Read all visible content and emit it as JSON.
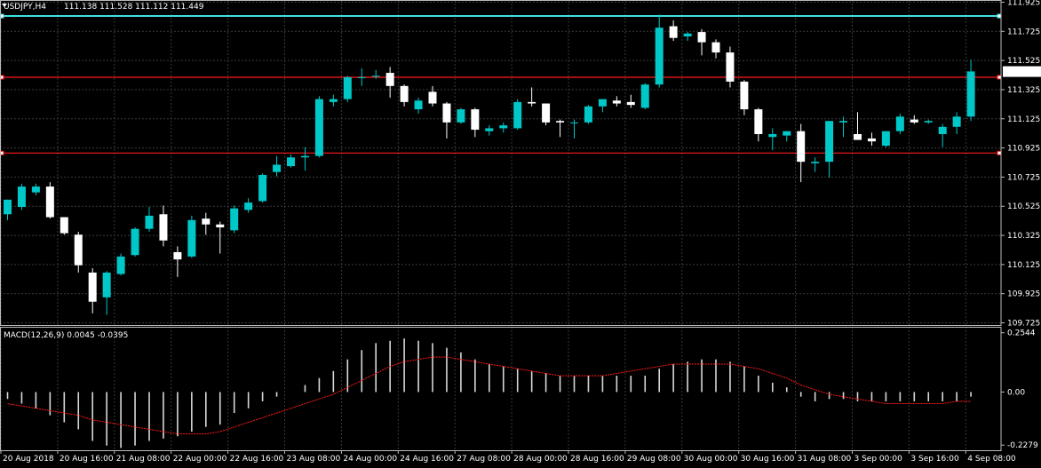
{
  "header": {
    "symbol": "USDJPY,H4",
    "ohlc": "111.138 111.528 111.112 111.449"
  },
  "macd_header": {
    "label": "MACD(12,26,9) 0.0045 -0.0395"
  },
  "colors": {
    "background": "#000000",
    "grid": "#3a3a3a",
    "bull": "#00c8c8",
    "bear": "#ffffff",
    "red_line": "#ff1a1a",
    "cyan_line": "#40e0e0",
    "signal": "#ff1a1a"
  },
  "chart_data": [
    {
      "type": "candlestick",
      "price_axis": {
        "ticks": [
          "111.925",
          "111.725",
          "111.525",
          "111.325",
          "111.125",
          "110.925",
          "110.725",
          "110.525",
          "110.325",
          "110.125",
          "109.925",
          "109.725"
        ],
        "ylim": [
          109.71,
          111.94
        ],
        "current_price_label": "111.449"
      },
      "time_axis": {
        "labels": [
          "20 Aug 2018",
          "20 Aug 16:00",
          "21 Aug 08:00",
          "22 Aug 00:00",
          "22 Aug 16:00",
          "23 Aug 08:00",
          "24 Aug 00:00",
          "24 Aug 16:00",
          "27 Aug 08:00",
          "28 Aug 00:00",
          "28 Aug 16:00",
          "29 Aug 08:00",
          "30 Aug 00:00",
          "30 Aug 16:00",
          "31 Aug 08:00",
          "3 Sep 00:00",
          "3 Sep 16:00",
          "4 Sep 08:00"
        ]
      },
      "horizontal_lines": [
        {
          "price": 111.83,
          "color": "cyan"
        },
        {
          "price": 111.41,
          "color": "red"
        },
        {
          "price": 110.89,
          "color": "red"
        }
      ],
      "candles": [
        {
          "o": 110.47,
          "h": 110.57,
          "l": 110.43,
          "c": 110.57
        },
        {
          "o": 110.52,
          "h": 110.68,
          "l": 110.5,
          "c": 110.66
        },
        {
          "o": 110.62,
          "h": 110.68,
          "l": 110.6,
          "c": 110.66
        },
        {
          "o": 110.66,
          "h": 110.69,
          "l": 110.44,
          "c": 110.45
        },
        {
          "o": 110.45,
          "h": 110.45,
          "l": 110.33,
          "c": 110.34
        },
        {
          "o": 110.33,
          "h": 110.35,
          "l": 110.07,
          "c": 110.12
        },
        {
          "o": 110.07,
          "h": 110.1,
          "l": 109.79,
          "c": 109.87
        },
        {
          "o": 109.9,
          "h": 110.08,
          "l": 109.78,
          "c": 110.07
        },
        {
          "o": 110.06,
          "h": 110.2,
          "l": 110.05,
          "c": 110.18
        },
        {
          "o": 110.19,
          "h": 110.38,
          "l": 110.18,
          "c": 110.37
        },
        {
          "o": 110.37,
          "h": 110.52,
          "l": 110.35,
          "c": 110.46
        },
        {
          "o": 110.47,
          "h": 110.53,
          "l": 110.25,
          "c": 110.29
        },
        {
          "o": 110.21,
          "h": 110.25,
          "l": 110.04,
          "c": 110.16
        },
        {
          "o": 110.18,
          "h": 110.46,
          "l": 110.17,
          "c": 110.43
        },
        {
          "o": 110.44,
          "h": 110.48,
          "l": 110.33,
          "c": 110.4
        },
        {
          "o": 110.4,
          "h": 110.42,
          "l": 110.2,
          "c": 110.38
        },
        {
          "o": 110.36,
          "h": 110.53,
          "l": 110.34,
          "c": 110.51
        },
        {
          "o": 110.5,
          "h": 110.58,
          "l": 110.48,
          "c": 110.55
        },
        {
          "o": 110.56,
          "h": 110.75,
          "l": 110.55,
          "c": 110.74
        },
        {
          "o": 110.76,
          "h": 110.87,
          "l": 110.73,
          "c": 110.81
        },
        {
          "o": 110.8,
          "h": 110.88,
          "l": 110.79,
          "c": 110.86
        },
        {
          "o": 110.86,
          "h": 110.93,
          "l": 110.77,
          "c": 110.87
        },
        {
          "o": 110.87,
          "h": 111.28,
          "l": 110.86,
          "c": 111.26
        },
        {
          "o": 111.24,
          "h": 111.29,
          "l": 111.21,
          "c": 111.26
        },
        {
          "o": 111.26,
          "h": 111.42,
          "l": 111.24,
          "c": 111.41
        },
        {
          "o": 111.41,
          "h": 111.47,
          "l": 111.35,
          "c": 111.41
        },
        {
          "o": 111.42,
          "h": 111.46,
          "l": 111.4,
          "c": 111.42
        },
        {
          "o": 111.44,
          "h": 111.48,
          "l": 111.27,
          "c": 111.35
        },
        {
          "o": 111.35,
          "h": 111.36,
          "l": 111.21,
          "c": 111.24
        },
        {
          "o": 111.19,
          "h": 111.27,
          "l": 111.16,
          "c": 111.25
        },
        {
          "o": 111.31,
          "h": 111.35,
          "l": 111.21,
          "c": 111.23
        },
        {
          "o": 111.23,
          "h": 111.24,
          "l": 110.99,
          "c": 111.1
        },
        {
          "o": 111.1,
          "h": 111.2,
          "l": 111.09,
          "c": 111.19
        },
        {
          "o": 111.19,
          "h": 111.2,
          "l": 111.0,
          "c": 111.05
        },
        {
          "o": 111.04,
          "h": 111.08,
          "l": 111.01,
          "c": 111.06
        },
        {
          "o": 111.06,
          "h": 111.1,
          "l": 111.03,
          "c": 111.08
        },
        {
          "o": 111.06,
          "h": 111.26,
          "l": 111.05,
          "c": 111.24
        },
        {
          "o": 111.24,
          "h": 111.34,
          "l": 111.21,
          "c": 111.23
        },
        {
          "o": 111.23,
          "h": 111.23,
          "l": 111.08,
          "c": 111.1
        },
        {
          "o": 111.11,
          "h": 111.12,
          "l": 111.0,
          "c": 111.1
        },
        {
          "o": 111.1,
          "h": 111.12,
          "l": 110.99,
          "c": 111.1
        },
        {
          "o": 111.1,
          "h": 111.22,
          "l": 111.09,
          "c": 111.21
        },
        {
          "o": 111.21,
          "h": 111.24,
          "l": 111.17,
          "c": 111.26
        },
        {
          "o": 111.25,
          "h": 111.28,
          "l": 111.21,
          "c": 111.23
        },
        {
          "o": 111.24,
          "h": 111.29,
          "l": 111.2,
          "c": 111.22
        },
        {
          "o": 111.2,
          "h": 111.37,
          "l": 111.19,
          "c": 111.36
        },
        {
          "o": 111.36,
          "h": 111.84,
          "l": 111.34,
          "c": 111.75
        },
        {
          "o": 111.76,
          "h": 111.8,
          "l": 111.66,
          "c": 111.68
        },
        {
          "o": 111.69,
          "h": 111.72,
          "l": 111.66,
          "c": 111.71
        },
        {
          "o": 111.72,
          "h": 111.74,
          "l": 111.56,
          "c": 111.65
        },
        {
          "o": 111.65,
          "h": 111.67,
          "l": 111.54,
          "c": 111.58
        },
        {
          "o": 111.58,
          "h": 111.62,
          "l": 111.34,
          "c": 111.38
        },
        {
          "o": 111.38,
          "h": 111.39,
          "l": 111.15,
          "c": 111.19
        },
        {
          "o": 111.19,
          "h": 111.2,
          "l": 110.97,
          "c": 111.02
        },
        {
          "o": 111.0,
          "h": 111.06,
          "l": 110.91,
          "c": 111.02
        },
        {
          "o": 111.01,
          "h": 111.04,
          "l": 110.97,
          "c": 111.04
        },
        {
          "o": 111.04,
          "h": 111.09,
          "l": 110.69,
          "c": 110.83
        },
        {
          "o": 110.82,
          "h": 110.86,
          "l": 110.76,
          "c": 110.83
        },
        {
          "o": 110.83,
          "h": 111.11,
          "l": 110.72,
          "c": 111.11
        },
        {
          "o": 111.1,
          "h": 111.14,
          "l": 111.0,
          "c": 111.11
        },
        {
          "o": 111.02,
          "h": 111.17,
          "l": 110.98,
          "c": 110.98
        },
        {
          "o": 110.99,
          "h": 111.03,
          "l": 110.94,
          "c": 110.97
        },
        {
          "o": 110.94,
          "h": 111.04,
          "l": 110.93,
          "c": 111.04
        },
        {
          "o": 111.04,
          "h": 111.16,
          "l": 111.02,
          "c": 111.14
        },
        {
          "o": 111.12,
          "h": 111.15,
          "l": 111.09,
          "c": 111.1
        },
        {
          "o": 111.1,
          "h": 111.12,
          "l": 111.09,
          "c": 111.11
        },
        {
          "o": 111.02,
          "h": 111.09,
          "l": 110.93,
          "c": 111.07
        },
        {
          "o": 111.07,
          "h": 111.17,
          "l": 111.02,
          "c": 111.14
        },
        {
          "o": 111.14,
          "h": 111.53,
          "l": 111.11,
          "c": 111.45
        }
      ]
    },
    {
      "type": "bar",
      "series_label": "MACD(12,26,9)",
      "value_axis": {
        "ticks": [
          "0.2544",
          "0.00",
          "-0.2279"
        ],
        "ylim": [
          -0.25,
          0.28
        ]
      },
      "histogram": [
        -0.03,
        -0.05,
        -0.07,
        -0.1,
        -0.13,
        -0.16,
        -0.21,
        -0.23,
        -0.24,
        -0.23,
        -0.21,
        -0.2,
        -0.19,
        -0.17,
        -0.15,
        -0.14,
        -0.09,
        -0.07,
        -0.04,
        -0.02,
        -0.0,
        0.03,
        0.06,
        0.09,
        0.14,
        0.18,
        0.21,
        0.22,
        0.23,
        0.22,
        0.21,
        0.19,
        0.17,
        0.14,
        0.12,
        0.11,
        0.1,
        0.09,
        0.08,
        0.07,
        0.07,
        0.07,
        0.07,
        0.07,
        0.07,
        0.07,
        0.1,
        0.12,
        0.13,
        0.14,
        0.14,
        0.13,
        0.11,
        0.07,
        0.04,
        0.02,
        -0.02,
        -0.04,
        -0.03,
        -0.03,
        -0.04,
        -0.04,
        -0.04,
        -0.04,
        -0.04,
        -0.04,
        -0.04,
        -0.04,
        -0.02
      ],
      "signal": [
        -0.05,
        -0.06,
        -0.07,
        -0.08,
        -0.09,
        -0.1,
        -0.12,
        -0.13,
        -0.14,
        -0.15,
        -0.16,
        -0.17,
        -0.18,
        -0.18,
        -0.18,
        -0.17,
        -0.15,
        -0.13,
        -0.11,
        -0.09,
        -0.07,
        -0.05,
        -0.03,
        -0.01,
        0.02,
        0.05,
        0.08,
        0.11,
        0.13,
        0.14,
        0.15,
        0.15,
        0.14,
        0.13,
        0.12,
        0.11,
        0.1,
        0.09,
        0.08,
        0.07,
        0.07,
        0.07,
        0.07,
        0.08,
        0.09,
        0.1,
        0.11,
        0.12,
        0.12,
        0.12,
        0.12,
        0.12,
        0.11,
        0.1,
        0.08,
        0.06,
        0.03,
        0.01,
        -0.01,
        -0.02,
        -0.03,
        -0.04,
        -0.05,
        -0.05,
        -0.05,
        -0.05,
        -0.05,
        -0.04,
        -0.04
      ]
    }
  ]
}
